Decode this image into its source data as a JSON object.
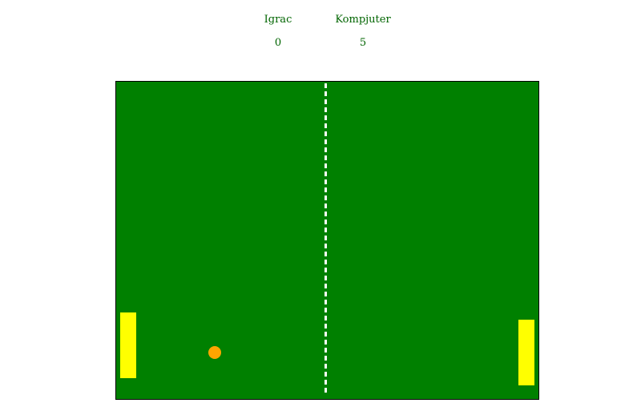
{
  "scoreboard": {
    "player": {
      "name": "Igrac",
      "score": "0"
    },
    "computer": {
      "name": "Kompjuter",
      "score": "5"
    }
  },
  "colors": {
    "court": "#008000",
    "court_border": "#000000",
    "net": "#ffffff",
    "paddle": "#ffff00",
    "ball": "#ffa500",
    "score_text": "#006400"
  }
}
